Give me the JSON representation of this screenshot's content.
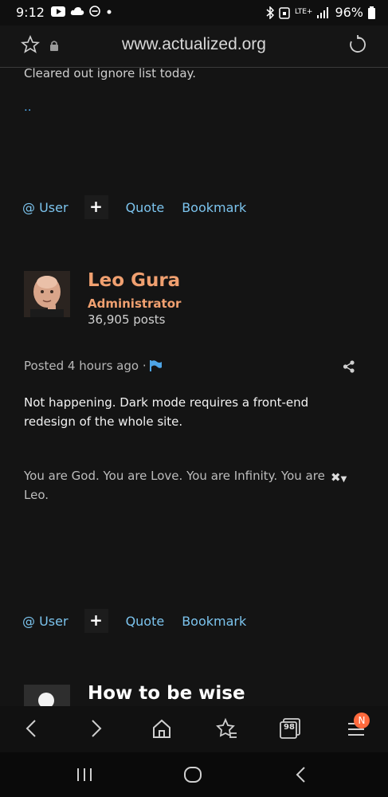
{
  "status_bar": {
    "time": "9:12",
    "network": "LTE+",
    "battery": "96%"
  },
  "browser": {
    "url": "www.actualized.org"
  },
  "previous_post": {
    "text": "Cleared out ignore list today.",
    "link": "..",
    "actions": {
      "user": "@ User",
      "plus": "+",
      "quote": "Quote",
      "bookmark": "Bookmark"
    }
  },
  "post": {
    "author": "Leo Gura",
    "role": "Administrator",
    "post_count": "36,905 posts",
    "posted": "Posted 4 hours ago ·",
    "body": "Not happening. Dark mode requires a front-end redesign of the whole site.",
    "signature": "You are God. You are Love. You are Infinity. You are Leo.",
    "actions": {
      "user": "@ User",
      "plus": "+",
      "quote": "Quote",
      "bookmark": "Bookmark"
    }
  },
  "next_post": {
    "title": "How to be wise"
  },
  "bottom_nav": {
    "tabs_count": "98",
    "badge": "N"
  },
  "colors": {
    "accent_link": "#7cc4ee",
    "author": "#f0a070",
    "badge": "#ff6a3d",
    "background": "#141414"
  },
  "icons": [
    "star-icon",
    "lock-icon",
    "reload-icon",
    "flag-icon",
    "share-icon",
    "back-icon",
    "forward-icon",
    "home-icon",
    "bookmarks-icon",
    "tabs-icon",
    "menu-icon"
  ]
}
